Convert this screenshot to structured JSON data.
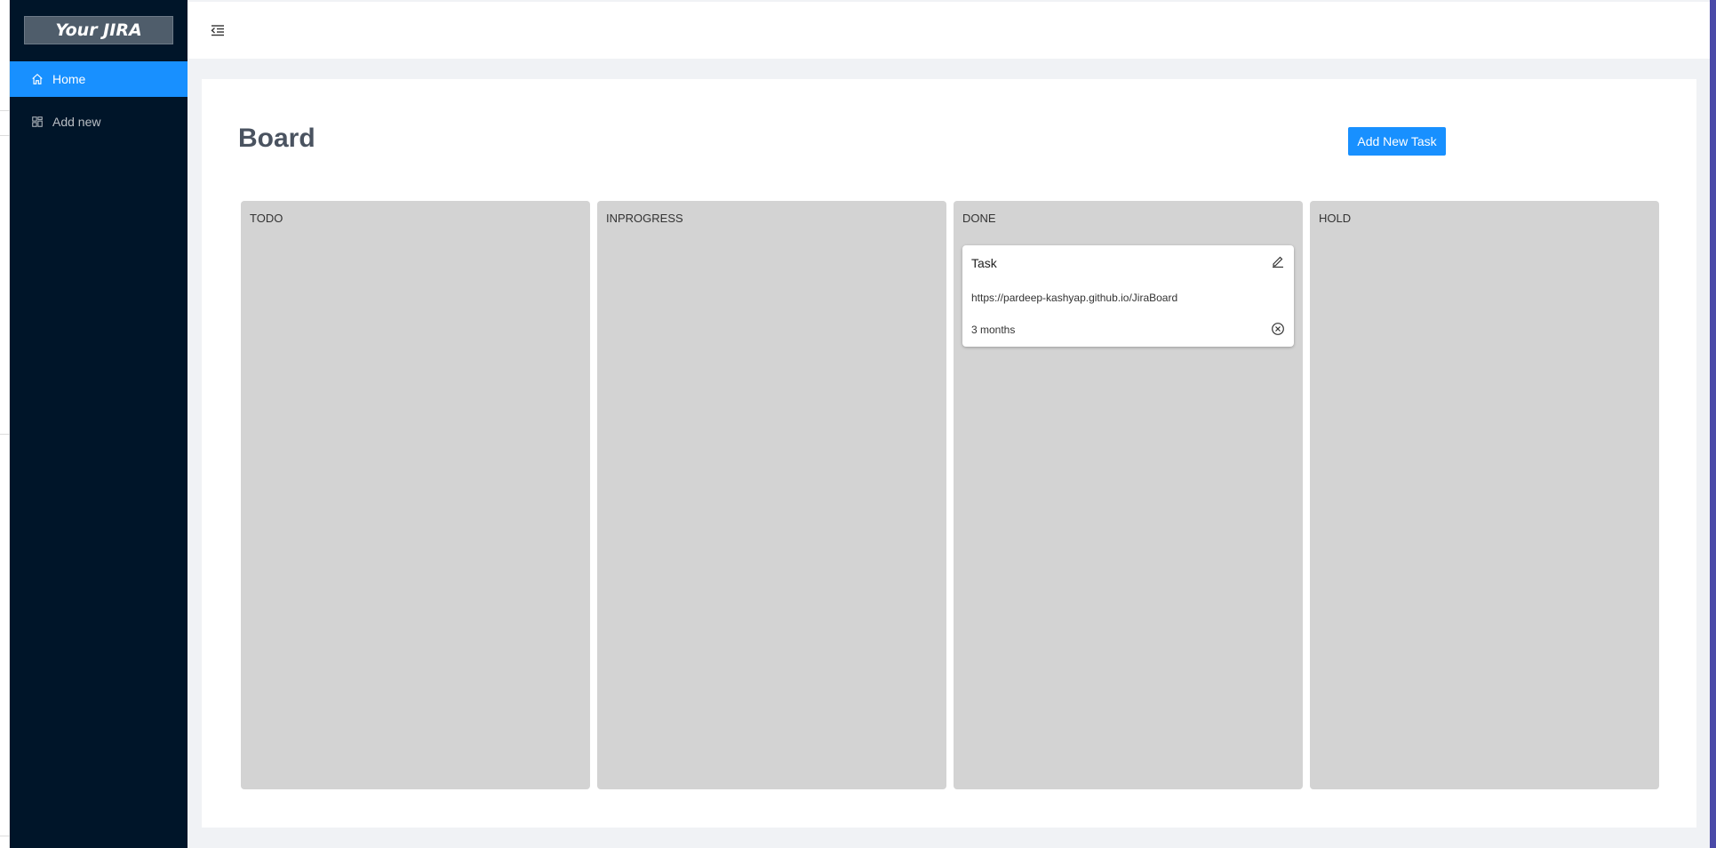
{
  "sidebar": {
    "logo": "Your JIRA",
    "items": [
      {
        "label": "Home",
        "icon": "home-icon",
        "active": true
      },
      {
        "label": "Add new",
        "icon": "layout-icon",
        "active": false
      }
    ]
  },
  "header": {
    "toggle_icon": "menu-fold-icon"
  },
  "board": {
    "title": "Board",
    "add_button_label": "Add New Task",
    "columns": [
      {
        "title": "TODO",
        "cards": []
      },
      {
        "title": "INPROGRESS",
        "cards": []
      },
      {
        "title": "DONE",
        "cards": [
          {
            "title": "Task",
            "link": "https://pardeep-kashyap.github.io/JiraBoard",
            "time": "3 months"
          }
        ]
      },
      {
        "title": "HOLD",
        "cards": []
      }
    ]
  },
  "colors": {
    "sider": "#001529",
    "accent": "#1890ff",
    "column": "#d3d3d3",
    "background": "#f0f2f5"
  }
}
